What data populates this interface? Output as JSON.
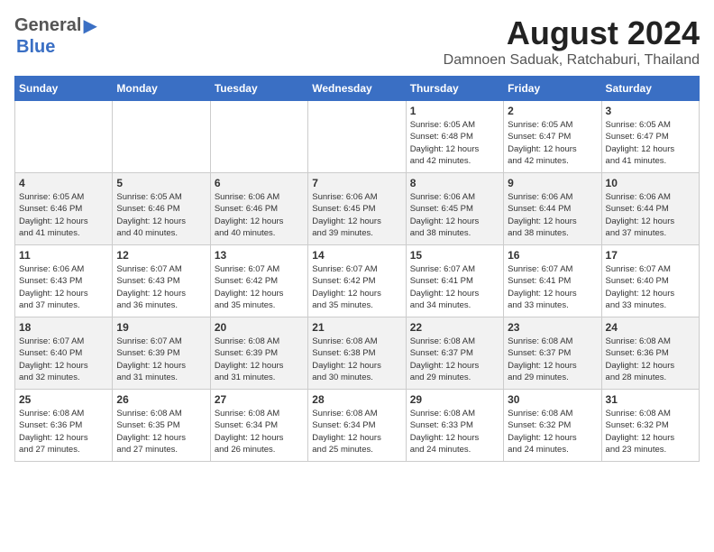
{
  "header": {
    "logo_general": "General",
    "logo_blue": "Blue",
    "title": "August 2024",
    "subtitle": "Damnoen Saduak, Ratchaburi, Thailand"
  },
  "columns": [
    "Sunday",
    "Monday",
    "Tuesday",
    "Wednesday",
    "Thursday",
    "Friday",
    "Saturday"
  ],
  "weeks": [
    {
      "days": [
        {
          "num": "",
          "info": ""
        },
        {
          "num": "",
          "info": ""
        },
        {
          "num": "",
          "info": ""
        },
        {
          "num": "",
          "info": ""
        },
        {
          "num": "1",
          "info": "Sunrise: 6:05 AM\nSunset: 6:48 PM\nDaylight: 12 hours\nand 42 minutes."
        },
        {
          "num": "2",
          "info": "Sunrise: 6:05 AM\nSunset: 6:47 PM\nDaylight: 12 hours\nand 42 minutes."
        },
        {
          "num": "3",
          "info": "Sunrise: 6:05 AM\nSunset: 6:47 PM\nDaylight: 12 hours\nand 41 minutes."
        }
      ]
    },
    {
      "days": [
        {
          "num": "4",
          "info": "Sunrise: 6:05 AM\nSunset: 6:46 PM\nDaylight: 12 hours\nand 41 minutes."
        },
        {
          "num": "5",
          "info": "Sunrise: 6:05 AM\nSunset: 6:46 PM\nDaylight: 12 hours\nand 40 minutes."
        },
        {
          "num": "6",
          "info": "Sunrise: 6:06 AM\nSunset: 6:46 PM\nDaylight: 12 hours\nand 40 minutes."
        },
        {
          "num": "7",
          "info": "Sunrise: 6:06 AM\nSunset: 6:45 PM\nDaylight: 12 hours\nand 39 minutes."
        },
        {
          "num": "8",
          "info": "Sunrise: 6:06 AM\nSunset: 6:45 PM\nDaylight: 12 hours\nand 38 minutes."
        },
        {
          "num": "9",
          "info": "Sunrise: 6:06 AM\nSunset: 6:44 PM\nDaylight: 12 hours\nand 38 minutes."
        },
        {
          "num": "10",
          "info": "Sunrise: 6:06 AM\nSunset: 6:44 PM\nDaylight: 12 hours\nand 37 minutes."
        }
      ]
    },
    {
      "days": [
        {
          "num": "11",
          "info": "Sunrise: 6:06 AM\nSunset: 6:43 PM\nDaylight: 12 hours\nand 37 minutes."
        },
        {
          "num": "12",
          "info": "Sunrise: 6:07 AM\nSunset: 6:43 PM\nDaylight: 12 hours\nand 36 minutes."
        },
        {
          "num": "13",
          "info": "Sunrise: 6:07 AM\nSunset: 6:42 PM\nDaylight: 12 hours\nand 35 minutes."
        },
        {
          "num": "14",
          "info": "Sunrise: 6:07 AM\nSunset: 6:42 PM\nDaylight: 12 hours\nand 35 minutes."
        },
        {
          "num": "15",
          "info": "Sunrise: 6:07 AM\nSunset: 6:41 PM\nDaylight: 12 hours\nand 34 minutes."
        },
        {
          "num": "16",
          "info": "Sunrise: 6:07 AM\nSunset: 6:41 PM\nDaylight: 12 hours\nand 33 minutes."
        },
        {
          "num": "17",
          "info": "Sunrise: 6:07 AM\nSunset: 6:40 PM\nDaylight: 12 hours\nand 33 minutes."
        }
      ]
    },
    {
      "days": [
        {
          "num": "18",
          "info": "Sunrise: 6:07 AM\nSunset: 6:40 PM\nDaylight: 12 hours\nand 32 minutes."
        },
        {
          "num": "19",
          "info": "Sunrise: 6:07 AM\nSunset: 6:39 PM\nDaylight: 12 hours\nand 31 minutes."
        },
        {
          "num": "20",
          "info": "Sunrise: 6:08 AM\nSunset: 6:39 PM\nDaylight: 12 hours\nand 31 minutes."
        },
        {
          "num": "21",
          "info": "Sunrise: 6:08 AM\nSunset: 6:38 PM\nDaylight: 12 hours\nand 30 minutes."
        },
        {
          "num": "22",
          "info": "Sunrise: 6:08 AM\nSunset: 6:37 PM\nDaylight: 12 hours\nand 29 minutes."
        },
        {
          "num": "23",
          "info": "Sunrise: 6:08 AM\nSunset: 6:37 PM\nDaylight: 12 hours\nand 29 minutes."
        },
        {
          "num": "24",
          "info": "Sunrise: 6:08 AM\nSunset: 6:36 PM\nDaylight: 12 hours\nand 28 minutes."
        }
      ]
    },
    {
      "days": [
        {
          "num": "25",
          "info": "Sunrise: 6:08 AM\nSunset: 6:36 PM\nDaylight: 12 hours\nand 27 minutes."
        },
        {
          "num": "26",
          "info": "Sunrise: 6:08 AM\nSunset: 6:35 PM\nDaylight: 12 hours\nand 27 minutes."
        },
        {
          "num": "27",
          "info": "Sunrise: 6:08 AM\nSunset: 6:34 PM\nDaylight: 12 hours\nand 26 minutes."
        },
        {
          "num": "28",
          "info": "Sunrise: 6:08 AM\nSunset: 6:34 PM\nDaylight: 12 hours\nand 25 minutes."
        },
        {
          "num": "29",
          "info": "Sunrise: 6:08 AM\nSunset: 6:33 PM\nDaylight: 12 hours\nand 24 minutes."
        },
        {
          "num": "30",
          "info": "Sunrise: 6:08 AM\nSunset: 6:32 PM\nDaylight: 12 hours\nand 24 minutes."
        },
        {
          "num": "31",
          "info": "Sunrise: 6:08 AM\nSunset: 6:32 PM\nDaylight: 12 hours\nand 23 minutes."
        }
      ]
    }
  ]
}
